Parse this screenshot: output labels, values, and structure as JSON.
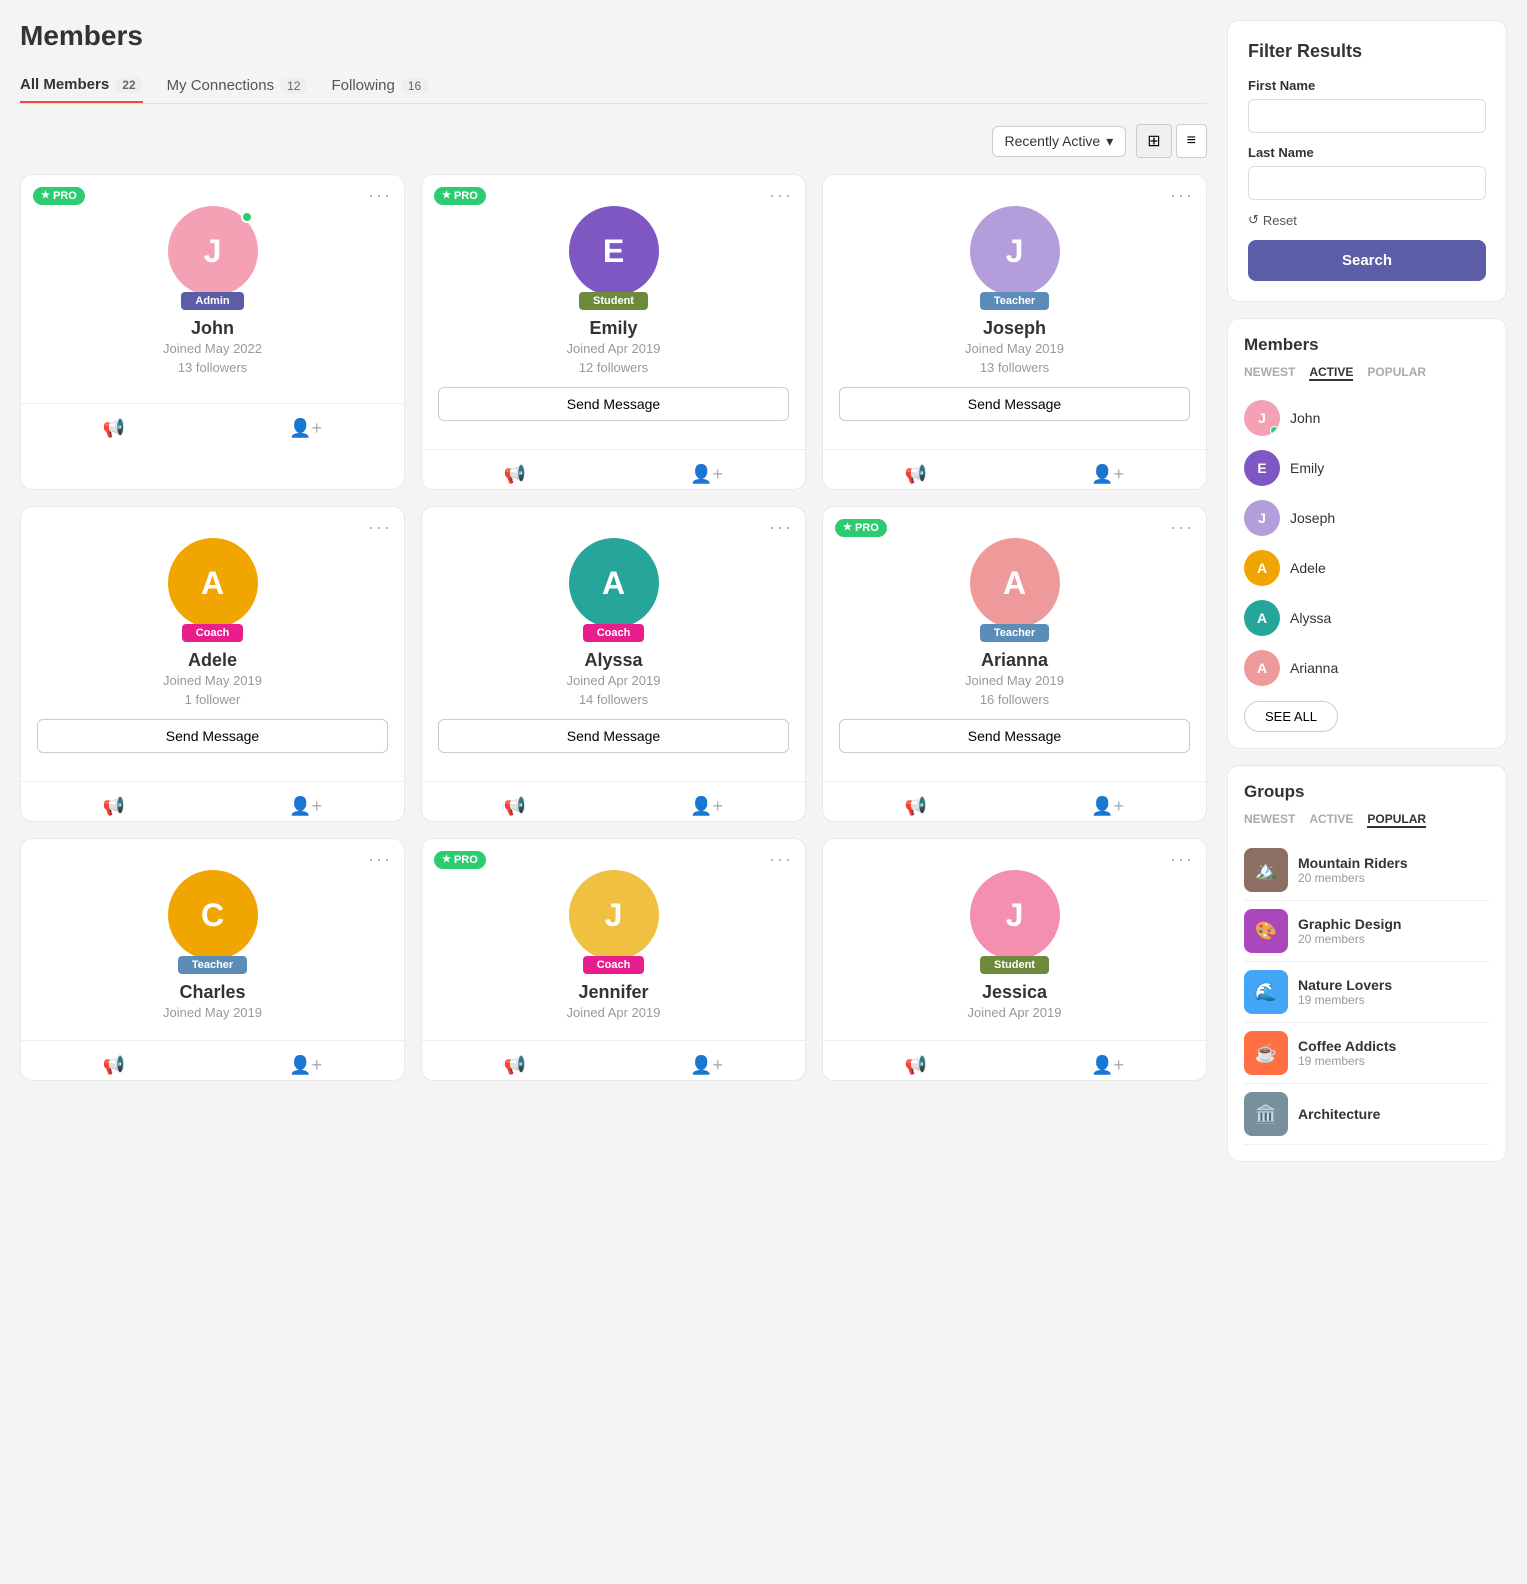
{
  "page": {
    "title": "Members"
  },
  "tabs": [
    {
      "id": "all",
      "label": "All Members",
      "count": "22",
      "active": true
    },
    {
      "id": "connections",
      "label": "My Connections",
      "count": "12",
      "active": false
    },
    {
      "id": "following",
      "label": "Following",
      "count": "16",
      "active": false
    }
  ],
  "toolbar": {
    "sort_label": "Recently Active",
    "grid_icon": "⊞",
    "list_icon": "≡"
  },
  "members": [
    {
      "id": "john",
      "name": "John",
      "joined": "Joined May 2022",
      "followers": "13 followers",
      "role": "Admin",
      "role_class": "role-admin",
      "pro": true,
      "online": true,
      "avatar_bg": "#f4a0b5",
      "avatar_letter": "J",
      "show_message": false
    },
    {
      "id": "emily",
      "name": "Emily",
      "joined": "Joined Apr 2019",
      "followers": "12 followers",
      "role": "Student",
      "role_class": "role-student",
      "pro": true,
      "online": false,
      "avatar_bg": "#7e57c2",
      "avatar_letter": "E",
      "show_message": true
    },
    {
      "id": "joseph",
      "name": "Joseph",
      "joined": "Joined May 2019",
      "followers": "13 followers",
      "role": "Teacher",
      "role_class": "role-teacher",
      "pro": false,
      "online": false,
      "avatar_bg": "#b39ddb",
      "avatar_letter": "J",
      "show_message": true
    },
    {
      "id": "adele",
      "name": "Adele",
      "joined": "Joined May 2019",
      "followers": "1 follower",
      "role": "Coach",
      "role_class": "role-coach",
      "pro": false,
      "online": false,
      "avatar_bg": "#f0a500",
      "avatar_letter": "A",
      "show_message": true
    },
    {
      "id": "alyssa",
      "name": "Alyssa",
      "joined": "Joined Apr 2019",
      "followers": "14 followers",
      "role": "Coach",
      "role_class": "role-coach",
      "pro": false,
      "online": false,
      "avatar_bg": "#26a69a",
      "avatar_letter": "A",
      "show_message": true
    },
    {
      "id": "arianna",
      "name": "Arianna",
      "joined": "Joined May 2019",
      "followers": "16 followers",
      "role": "Teacher",
      "role_class": "role-teacher",
      "pro": true,
      "online": false,
      "avatar_bg": "#ef9a9a",
      "avatar_letter": "A",
      "show_message": true
    },
    {
      "id": "charles",
      "name": "Charles",
      "joined": "Joined May 2019",
      "followers": "",
      "role": "Teacher",
      "role_class": "role-teacher",
      "pro": false,
      "online": false,
      "avatar_bg": "#f0a500",
      "avatar_letter": "C",
      "show_message": false
    },
    {
      "id": "jennifer",
      "name": "Jennifer",
      "joined": "Joined Apr 2019",
      "followers": "",
      "role": "Coach",
      "role_class": "role-coach",
      "pro": true,
      "online": false,
      "avatar_bg": "#f0c040",
      "avatar_letter": "J",
      "show_message": false
    },
    {
      "id": "jessica",
      "name": "Jessica",
      "joined": "Joined Apr 2019",
      "followers": "",
      "role": "Student",
      "role_class": "role-student",
      "pro": false,
      "online": false,
      "avatar_bg": "#f48fb1",
      "avatar_letter": "J",
      "show_message": false
    }
  ],
  "filter": {
    "title": "Filter Results",
    "first_name_label": "First Name",
    "first_name_placeholder": "",
    "last_name_label": "Last Name",
    "last_name_placeholder": "",
    "reset_label": "Reset",
    "search_label": "Search"
  },
  "sidebar_members": {
    "title": "Members",
    "tabs": [
      "NEWEST",
      "ACTIVE",
      "POPULAR"
    ],
    "active_tab": "ACTIVE",
    "items": [
      {
        "name": "John",
        "online": true,
        "avatar_bg": "#f4a0b5",
        "avatar_letter": "J"
      },
      {
        "name": "Emily",
        "online": false,
        "avatar_bg": "#7e57c2",
        "avatar_letter": "E"
      },
      {
        "name": "Joseph",
        "online": false,
        "avatar_bg": "#b39ddb",
        "avatar_letter": "J"
      },
      {
        "name": "Adele",
        "online": false,
        "avatar_bg": "#f0a500",
        "avatar_letter": "A"
      },
      {
        "name": "Alyssa",
        "online": false,
        "avatar_bg": "#26a69a",
        "avatar_letter": "A"
      },
      {
        "name": "Arianna",
        "online": false,
        "avatar_bg": "#ef9a9a",
        "avatar_letter": "A"
      }
    ],
    "see_all_label": "SEE ALL"
  },
  "sidebar_groups": {
    "title": "Groups",
    "tabs": [
      "NEWEST",
      "ACTIVE",
      "POPULAR"
    ],
    "active_tab": "POPULAR",
    "items": [
      {
        "name": "Mountain Riders",
        "members": "20 members",
        "icon": "🏔️",
        "color": "#8d6e63"
      },
      {
        "name": "Graphic Design",
        "members": "20 members",
        "icon": "🎨",
        "color": "#ab47bc"
      },
      {
        "name": "Nature Lovers",
        "members": "19 members",
        "icon": "🌊",
        "color": "#42a5f5"
      },
      {
        "name": "Coffee Addicts",
        "members": "19 members",
        "icon": "☕",
        "color": "#ff7043"
      },
      {
        "name": "Architecture",
        "members": "",
        "icon": "🏛️",
        "color": "#78909c"
      }
    ]
  },
  "button_labels": {
    "send_message": "Send Message"
  }
}
